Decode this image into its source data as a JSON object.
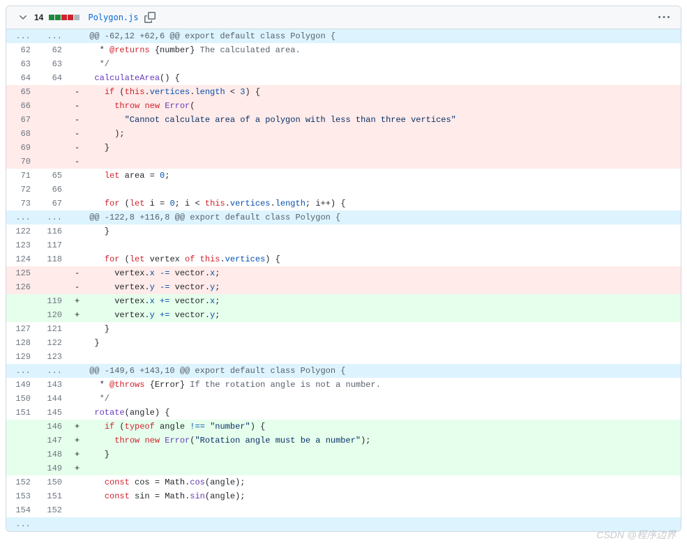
{
  "header": {
    "lines_changed": "14",
    "filename": "Polygon.js",
    "diffstat": {
      "added": 2,
      "deleted": 2,
      "neutral": 1
    }
  },
  "hunks": [
    {
      "header": "@@ -62,12 +62,6 @@ export default class Polygon {",
      "lines": [
        {
          "type": "ctx",
          "old": "62",
          "new": "62",
          "tokens": [
            [
              "   * ",
              "pl"
            ],
            [
              "@returns",
              "tag"
            ],
            [
              " ",
              "pl"
            ],
            [
              "{number}",
              "type"
            ],
            [
              " The calculated area.",
              "comment"
            ]
          ]
        },
        {
          "type": "ctx",
          "old": "63",
          "new": "63",
          "tokens": [
            [
              "   */",
              "comment"
            ]
          ]
        },
        {
          "type": "ctx",
          "old": "64",
          "new": "64",
          "tokens": [
            [
              "  ",
              "pl"
            ],
            [
              "calculateArea",
              "func"
            ],
            [
              "() {",
              "pl"
            ]
          ]
        },
        {
          "type": "del",
          "old": "65",
          "new": "",
          "tokens": [
            [
              "    ",
              "pl"
            ],
            [
              "if",
              "kw"
            ],
            [
              " (",
              "pl"
            ],
            [
              "this",
              "kw"
            ],
            [
              ".",
              "pl"
            ],
            [
              "vertices",
              "prop"
            ],
            [
              ".",
              "pl"
            ],
            [
              "length",
              "prop"
            ],
            [
              " < ",
              "pl"
            ],
            [
              "3",
              "num"
            ],
            [
              ") {",
              "pl"
            ]
          ]
        },
        {
          "type": "del",
          "old": "66",
          "new": "",
          "tokens": [
            [
              "      ",
              "pl"
            ],
            [
              "throw",
              "kw"
            ],
            [
              " ",
              "pl"
            ],
            [
              "new",
              "kw"
            ],
            [
              " ",
              "pl"
            ],
            [
              "Error",
              "func"
            ],
            [
              "(",
              "pl"
            ]
          ]
        },
        {
          "type": "del",
          "old": "67",
          "new": "",
          "tokens": [
            [
              "        ",
              "pl"
            ],
            [
              "\"Cannot calculate area of a polygon with less than three vertices\"",
              "str"
            ]
          ]
        },
        {
          "type": "del",
          "old": "68",
          "new": "",
          "tokens": [
            [
              "      );",
              "pl"
            ]
          ]
        },
        {
          "type": "del",
          "old": "69",
          "new": "",
          "tokens": [
            [
              "    }",
              "pl"
            ]
          ]
        },
        {
          "type": "del",
          "old": "70",
          "new": "",
          "tokens": [
            [
              "",
              "pl"
            ]
          ]
        },
        {
          "type": "ctx",
          "old": "71",
          "new": "65",
          "tokens": [
            [
              "    ",
              "pl"
            ],
            [
              "let",
              "kw"
            ],
            [
              " area = ",
              "pl"
            ],
            [
              "0",
              "num"
            ],
            [
              ";",
              "pl"
            ]
          ]
        },
        {
          "type": "ctx",
          "old": "72",
          "new": "66",
          "tokens": [
            [
              "",
              "pl"
            ]
          ]
        },
        {
          "type": "ctx",
          "old": "73",
          "new": "67",
          "tokens": [
            [
              "    ",
              "pl"
            ],
            [
              "for",
              "kw"
            ],
            [
              " (",
              "pl"
            ],
            [
              "let",
              "kw"
            ],
            [
              " i = ",
              "pl"
            ],
            [
              "0",
              "num"
            ],
            [
              "; i < ",
              "pl"
            ],
            [
              "this",
              "kw"
            ],
            [
              ".",
              "pl"
            ],
            [
              "vertices",
              "prop"
            ],
            [
              ".",
              "pl"
            ],
            [
              "length",
              "prop"
            ],
            [
              "; i++) {",
              "pl"
            ]
          ]
        }
      ]
    },
    {
      "header": "@@ -122,8 +116,8 @@ export default class Polygon {",
      "lines": [
        {
          "type": "ctx",
          "old": "122",
          "new": "116",
          "tokens": [
            [
              "    }",
              "pl"
            ]
          ]
        },
        {
          "type": "ctx",
          "old": "123",
          "new": "117",
          "tokens": [
            [
              "",
              "pl"
            ]
          ]
        },
        {
          "type": "ctx",
          "old": "124",
          "new": "118",
          "tokens": [
            [
              "    ",
              "pl"
            ],
            [
              "for",
              "kw"
            ],
            [
              " (",
              "pl"
            ],
            [
              "let",
              "kw"
            ],
            [
              " vertex ",
              "pl"
            ],
            [
              "of",
              "kw"
            ],
            [
              " ",
              "pl"
            ],
            [
              "this",
              "kw"
            ],
            [
              ".",
              "pl"
            ],
            [
              "vertices",
              "prop"
            ],
            [
              ") {",
              "pl"
            ]
          ]
        },
        {
          "type": "del",
          "old": "125",
          "new": "",
          "tokens": [
            [
              "      vertex.",
              "pl"
            ],
            [
              "x",
              "prop"
            ],
            [
              " ",
              "pl"
            ],
            [
              "-=",
              "op"
            ],
            [
              " vector.",
              "pl"
            ],
            [
              "x",
              "prop"
            ],
            [
              ";",
              "pl"
            ]
          ]
        },
        {
          "type": "del",
          "old": "126",
          "new": "",
          "tokens": [
            [
              "      vertex.",
              "pl"
            ],
            [
              "y",
              "prop"
            ],
            [
              " ",
              "pl"
            ],
            [
              "-=",
              "op"
            ],
            [
              " vector.",
              "pl"
            ],
            [
              "y",
              "prop"
            ],
            [
              ";",
              "pl"
            ]
          ]
        },
        {
          "type": "add",
          "old": "",
          "new": "119",
          "tokens": [
            [
              "      vertex.",
              "pl"
            ],
            [
              "x",
              "prop"
            ],
            [
              " ",
              "pl"
            ],
            [
              "+=",
              "op"
            ],
            [
              " vector.",
              "pl"
            ],
            [
              "x",
              "prop"
            ],
            [
              ";",
              "pl"
            ]
          ]
        },
        {
          "type": "add",
          "old": "",
          "new": "120",
          "tokens": [
            [
              "      vertex.",
              "pl"
            ],
            [
              "y",
              "prop"
            ],
            [
              " ",
              "pl"
            ],
            [
              "+=",
              "op"
            ],
            [
              " vector.",
              "pl"
            ],
            [
              "y",
              "prop"
            ],
            [
              ";",
              "pl"
            ]
          ]
        },
        {
          "type": "ctx",
          "old": "127",
          "new": "121",
          "tokens": [
            [
              "    }",
              "pl"
            ]
          ]
        },
        {
          "type": "ctx",
          "old": "128",
          "new": "122",
          "tokens": [
            [
              "  }",
              "pl"
            ]
          ]
        },
        {
          "type": "ctx",
          "old": "129",
          "new": "123",
          "tokens": [
            [
              "",
              "pl"
            ]
          ]
        }
      ]
    },
    {
      "header": "@@ -149,6 +143,10 @@ export default class Polygon {",
      "lines": [
        {
          "type": "ctx",
          "old": "149",
          "new": "143",
          "tokens": [
            [
              "   * ",
              "pl"
            ],
            [
              "@throws",
              "tag"
            ],
            [
              " ",
              "pl"
            ],
            [
              "{Error}",
              "type"
            ],
            [
              " If the rotation angle is not a number.",
              "comment"
            ]
          ]
        },
        {
          "type": "ctx",
          "old": "150",
          "new": "144",
          "tokens": [
            [
              "   */",
              "comment"
            ]
          ]
        },
        {
          "type": "ctx",
          "old": "151",
          "new": "145",
          "tokens": [
            [
              "  ",
              "pl"
            ],
            [
              "rotate",
              "func"
            ],
            [
              "(angle) {",
              "pl"
            ]
          ]
        },
        {
          "type": "add",
          "old": "",
          "new": "146",
          "tokens": [
            [
              "    ",
              "pl"
            ],
            [
              "if",
              "kw"
            ],
            [
              " (",
              "pl"
            ],
            [
              "typeof",
              "kw"
            ],
            [
              " angle ",
              "pl"
            ],
            [
              "!==",
              "op"
            ],
            [
              " ",
              "pl"
            ],
            [
              "\"number\"",
              "str"
            ],
            [
              ") {",
              "pl"
            ]
          ]
        },
        {
          "type": "add",
          "old": "",
          "new": "147",
          "tokens": [
            [
              "      ",
              "pl"
            ],
            [
              "throw",
              "kw"
            ],
            [
              " ",
              "pl"
            ],
            [
              "new",
              "kw"
            ],
            [
              " ",
              "pl"
            ],
            [
              "Error",
              "func"
            ],
            [
              "(",
              "pl"
            ],
            [
              "\"Rotation angle must be a number\"",
              "str"
            ],
            [
              ");",
              "pl"
            ]
          ]
        },
        {
          "type": "add",
          "old": "",
          "new": "148",
          "tokens": [
            [
              "    }",
              "pl"
            ]
          ]
        },
        {
          "type": "add",
          "old": "",
          "new": "149",
          "tokens": [
            [
              "",
              "pl"
            ]
          ]
        },
        {
          "type": "ctx",
          "old": "152",
          "new": "150",
          "tokens": [
            [
              "    ",
              "pl"
            ],
            [
              "const",
              "kw"
            ],
            [
              " cos = ",
              "pl"
            ],
            [
              "Math",
              "var"
            ],
            [
              ".",
              "pl"
            ],
            [
              "cos",
              "func"
            ],
            [
              "(angle);",
              "pl"
            ]
          ]
        },
        {
          "type": "ctx",
          "old": "153",
          "new": "151",
          "tokens": [
            [
              "    ",
              "pl"
            ],
            [
              "const",
              "kw"
            ],
            [
              " sin = ",
              "pl"
            ],
            [
              "Math",
              "var"
            ],
            [
              ".",
              "pl"
            ],
            [
              "sin",
              "func"
            ],
            [
              "(angle);",
              "pl"
            ]
          ]
        },
        {
          "type": "ctx",
          "old": "154",
          "new": "152",
          "tokens": [
            [
              "",
              "pl"
            ]
          ]
        }
      ],
      "trailing_expand": true
    }
  ],
  "watermark": "CSDN @程序边界"
}
